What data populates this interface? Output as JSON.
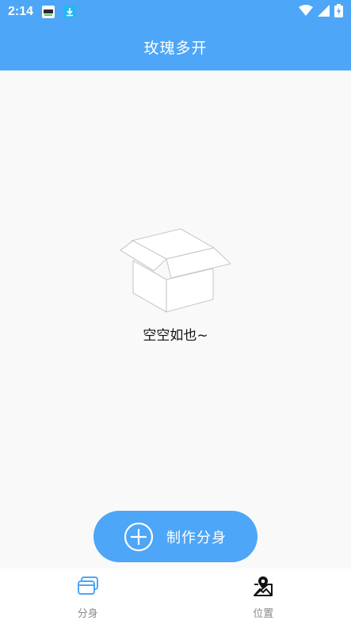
{
  "status_bar": {
    "time": "2:14",
    "icons": [
      "app-notification-icon",
      "download-icon",
      "wifi-icon",
      "signal-icon",
      "battery-charging-icon"
    ]
  },
  "app_bar": {
    "title": "玫瑰多开"
  },
  "empty_state": {
    "icon": "empty-box-icon",
    "text": "空空如也~"
  },
  "create_button": {
    "label": "制作分身",
    "icon": "plus-circle-icon"
  },
  "bottom_nav": {
    "items": [
      {
        "label": "分身",
        "icon": "clone-icon",
        "active": true
      },
      {
        "label": "位置",
        "icon": "location-map-icon",
        "active": false
      }
    ]
  },
  "colors": {
    "primary": "#4da6f7",
    "background": "#f9f9f9",
    "nav_label": "#8a8a8a"
  }
}
